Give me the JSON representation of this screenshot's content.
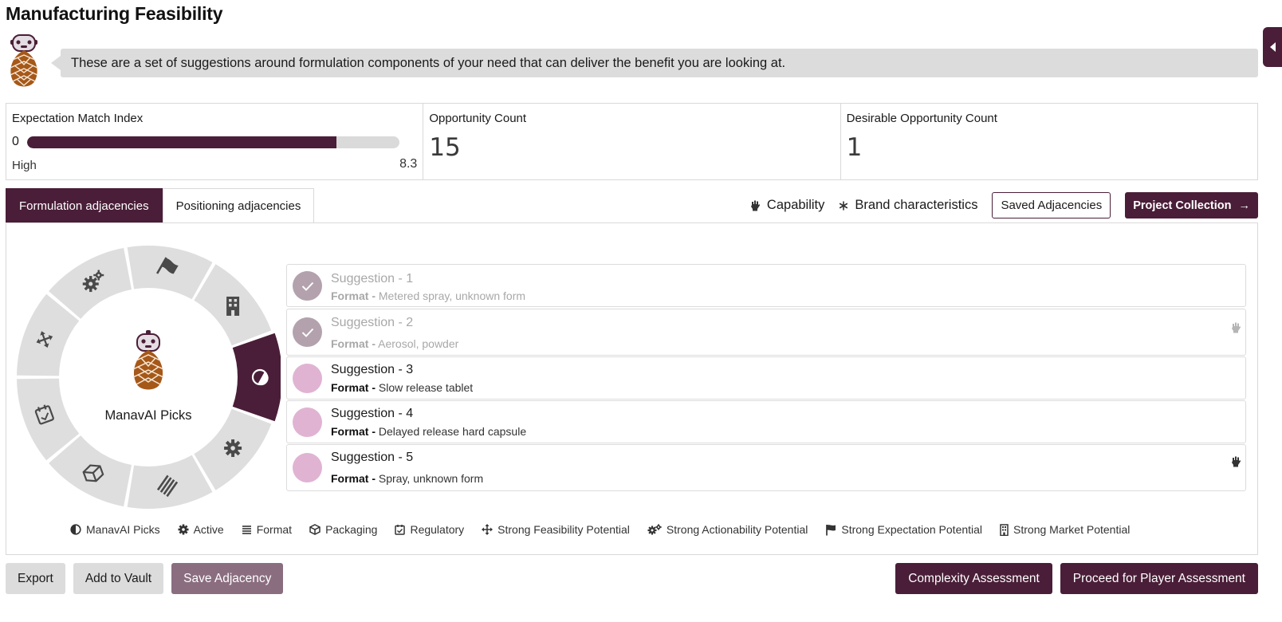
{
  "page": {
    "title": "Manufacturing Feasibility"
  },
  "intro": {
    "message": "These are a set of suggestions around formulation components of your need that can deliver the benefit you are looking at."
  },
  "metrics": {
    "expectation_match": {
      "label": "Expectation Match Index",
      "min": "0",
      "level": "High",
      "score": "8.3",
      "fill_fraction": 0.83
    },
    "opportunity_count": {
      "label": "Opportunity Count",
      "value": "15"
    },
    "desirable_opportunity_count": {
      "label": "Desirable Opportunity Count",
      "value": "1"
    }
  },
  "tabs": [
    {
      "label": "Formulation adjacencies",
      "active": true
    },
    {
      "label": "Positioning adjacencies",
      "active": false
    }
  ],
  "toolbar": {
    "capability_label": "Capability",
    "brand_label": "Brand characteristics",
    "saved_label": "Saved Adjacencies",
    "project_label": "Project Collection",
    "arrow_glyph": "→"
  },
  "wheel": {
    "center_label": "ManavAI Picks",
    "active_segment": "manavai-picks",
    "segments": [
      {
        "name": "strong-actionability",
        "icon": "cogs-icon"
      },
      {
        "name": "strong-expectation",
        "icon": "flag-icon"
      },
      {
        "name": "strong-market",
        "icon": "building-icon"
      },
      {
        "name": "manavai-picks",
        "icon": "half-circle-icon"
      },
      {
        "name": "active",
        "icon": "gear-icon"
      },
      {
        "name": "format",
        "icon": "lines-icon"
      },
      {
        "name": "packaging",
        "icon": "box-icon"
      },
      {
        "name": "regulatory",
        "icon": "clipboard-check-icon"
      },
      {
        "name": "strong-feasibility",
        "icon": "arrows-icon"
      }
    ]
  },
  "suggestions": [
    {
      "title": "Suggestion - 1",
      "format_label": "Format -",
      "format_value": "Metered spray, unknown form",
      "done": true,
      "capability": false
    },
    {
      "title": "Suggestion - 2",
      "format_label": "Format -",
      "format_value": "Aerosol, powder",
      "done": true,
      "capability": true
    },
    {
      "title": "Suggestion - 3",
      "format_label": "Format -",
      "format_value": "Slow release tablet",
      "done": false,
      "capability": false
    },
    {
      "title": "Suggestion - 4",
      "format_label": "Format -",
      "format_value": "Delayed release hard capsule",
      "done": false,
      "capability": false
    },
    {
      "title": "Suggestion - 5",
      "format_label": "Format -",
      "format_value": "Spray, unknown form",
      "done": false,
      "capability": true
    }
  ],
  "legend": [
    {
      "label": "ManavAI Picks",
      "icon": "half-circle-icon"
    },
    {
      "label": "Active",
      "icon": "gear-icon"
    },
    {
      "label": "Format",
      "icon": "lines-icon"
    },
    {
      "label": "Packaging",
      "icon": "box-icon"
    },
    {
      "label": "Regulatory",
      "icon": "clipboard-check-icon"
    },
    {
      "label": "Strong Feasibility Potential",
      "icon": "arrows-icon"
    },
    {
      "label": "Strong Actionability Potential",
      "icon": "cogs-icon"
    },
    {
      "label": "Strong Expectation Potential",
      "icon": "flag-icon"
    },
    {
      "label": "Strong Market Potential",
      "icon": "building-icon"
    }
  ],
  "actions": {
    "export": "Export",
    "add_to_vault": "Add to Vault",
    "save_adjacency": "Save Adjacency",
    "complexity": "Complexity Assessment",
    "proceed": "Proceed for Player Assessment"
  },
  "colors": {
    "brand": "#4a1e38",
    "suggestion_dot": "#e0b3d3",
    "suggestion_dot_done": "#b3a2ad",
    "wheel_segment": "#dedede"
  }
}
